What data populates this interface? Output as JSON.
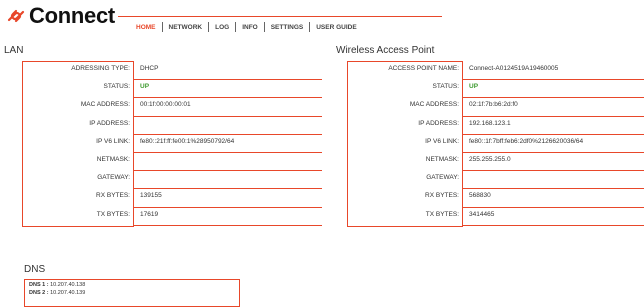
{
  "header": {
    "logo_text": "Connect",
    "nav": [
      "HOME",
      "NETWORK",
      "LOG",
      "INFO",
      "SETTINGS",
      "USER GUIDE"
    ],
    "active_nav": "HOME"
  },
  "lan": {
    "title": "LAN",
    "rows": [
      {
        "label": "ADRESSING TYPE:",
        "value": "DHCP"
      },
      {
        "label": "STATUS:",
        "value": "UP"
      },
      {
        "label": "MAC ADDRESS:",
        "value": "00:1f:00:00:00:01"
      },
      {
        "label": "IP ADDRESS:",
        "value": ""
      },
      {
        "label": "IP V6 LINK:",
        "value": "fe80::21f:ff:fe00:1%28950792/64"
      },
      {
        "label": "NETMASK:",
        "value": ""
      },
      {
        "label": "GATEWAY:",
        "value": ""
      },
      {
        "label": "RX BYTES:",
        "value": "139155"
      },
      {
        "label": "TX BYTES:",
        "value": "17619"
      }
    ]
  },
  "wap": {
    "title": "Wireless Access Point",
    "rows": [
      {
        "label": "ACCESS POINT NAME:",
        "value": "Connect-A0124519A19460005"
      },
      {
        "label": "STATUS:",
        "value": "UP"
      },
      {
        "label": "MAC ADDRESS:",
        "value": "02:1f:7b:b6:2d:f0"
      },
      {
        "label": "IP ADDRESS:",
        "value": "192.168.123.1"
      },
      {
        "label": "IP V6 LINK:",
        "value": "fe80::1f:7bff:feb6:2df0%2126620036/64"
      },
      {
        "label": "NETMASK:",
        "value": "255.255.255.0"
      },
      {
        "label": "GATEWAY:",
        "value": ""
      },
      {
        "label": "RX BYTES:",
        "value": "568830"
      },
      {
        "label": "TX BYTES:",
        "value": "3414465"
      }
    ]
  },
  "dns": {
    "title": "DNS",
    "entries": [
      {
        "label": "DNS 1 :",
        "value": "10.207.40.138"
      },
      {
        "label": "DNS 2 :",
        "value": "10.207.40.139"
      }
    ]
  },
  "colors": {
    "accent": "#e8472a",
    "status_up": "#3c9a2e"
  }
}
